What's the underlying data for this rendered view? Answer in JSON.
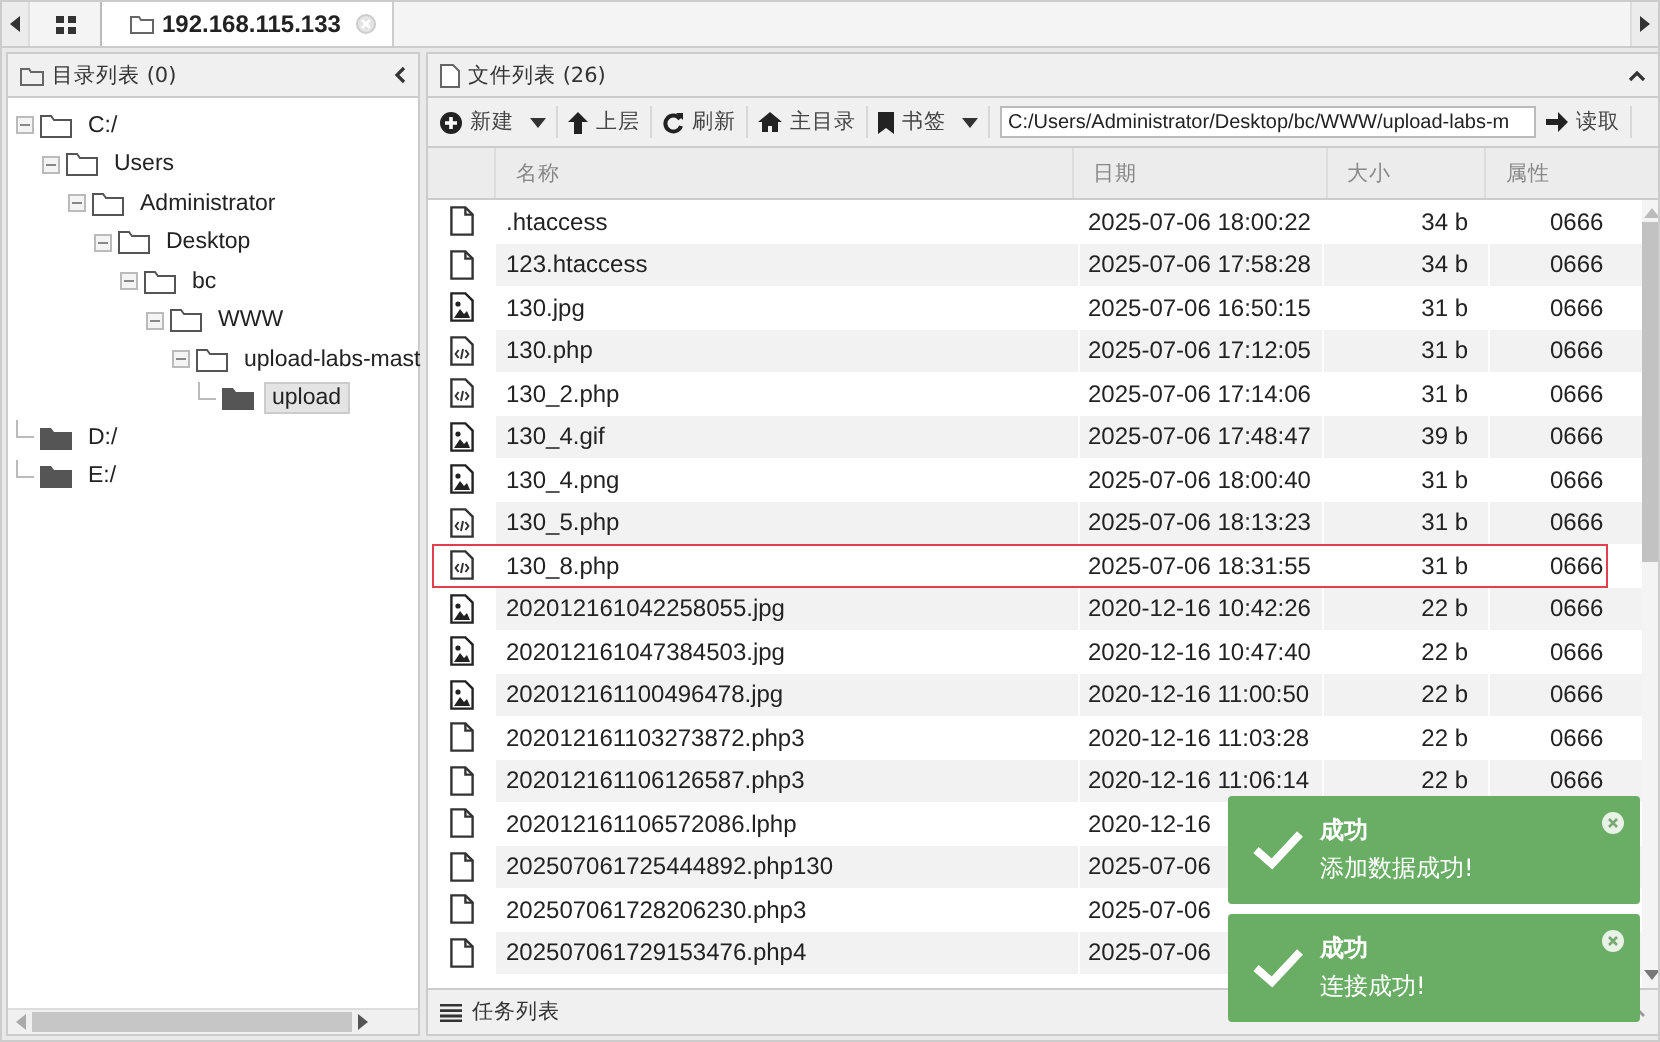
{
  "tabs": [
    {
      "label": "192.168.115.133",
      "selected": true
    }
  ],
  "tree_panel": {
    "title": "目录列表 (0)",
    "tree": [
      {
        "label": "C:/",
        "expanded": true,
        "selected": false,
        "children": [
          {
            "label": "Users",
            "expanded": true,
            "selected": false,
            "children": [
              {
                "label": "Administrator",
                "expanded": true,
                "selected": false,
                "children": [
                  {
                    "label": "Desktop",
                    "expanded": true,
                    "selected": false,
                    "children": [
                      {
                        "label": "bc",
                        "expanded": true,
                        "selected": false,
                        "children": [
                          {
                            "label": "WWW",
                            "expanded": true,
                            "selected": false,
                            "children": [
                              {
                                "label": "upload-labs-mast",
                                "expanded": true,
                                "selected": false,
                                "children": [
                                  {
                                    "label": "upload",
                                    "expanded": false,
                                    "selected": true
                                  }
                                ]
                              }
                            ]
                          }
                        ]
                      }
                    ]
                  }
                ]
              }
            ]
          }
        ]
      },
      {
        "label": "D:/",
        "expanded": false,
        "selected": false
      },
      {
        "label": "E:/",
        "expanded": false,
        "selected": false
      }
    ]
  },
  "file_panel": {
    "title": "文件列表 (26)",
    "toolbar": [
      {
        "label": "新建",
        "dropdown": true
      },
      {
        "label": "上层",
        "dropdown": false
      },
      {
        "label": "刷新",
        "dropdown": false
      },
      {
        "label": "主目录",
        "dropdown": false
      },
      {
        "label": "书签",
        "dropdown": true
      }
    ],
    "path": "C:/Users/Administrator/Desktop/bc/WWW/upload-labs-m",
    "read_button": "读取",
    "columns": [
      "名称",
      "日期",
      "大小",
      "属性"
    ],
    "rows": [
      {
        "kind": "file",
        "name": ".htaccess",
        "date": "2025-07-06 18:00:22",
        "size": "34 b",
        "attr": "0666",
        "highlighted": false
      },
      {
        "kind": "file",
        "name": "123.htaccess",
        "date": "2025-07-06 17:58:28",
        "size": "34 b",
        "attr": "0666",
        "highlighted": false
      },
      {
        "kind": "image",
        "name": "130.jpg",
        "date": "2025-07-06 16:50:15",
        "size": "31 b",
        "attr": "0666",
        "highlighted": false
      },
      {
        "kind": "code",
        "name": "130.php",
        "date": "2025-07-06 17:12:05",
        "size": "31 b",
        "attr": "0666",
        "highlighted": false
      },
      {
        "kind": "code",
        "name": "130_2.php",
        "date": "2025-07-06 17:14:06",
        "size": "31 b",
        "attr": "0666",
        "highlighted": false
      },
      {
        "kind": "image",
        "name": "130_4.gif",
        "date": "2025-07-06 17:48:47",
        "size": "39 b",
        "attr": "0666",
        "highlighted": false
      },
      {
        "kind": "image",
        "name": "130_4.png",
        "date": "2025-07-06 18:00:40",
        "size": "31 b",
        "attr": "0666",
        "highlighted": false
      },
      {
        "kind": "code",
        "name": "130_5.php",
        "date": "2025-07-06 18:13:23",
        "size": "31 b",
        "attr": "0666",
        "highlighted": false
      },
      {
        "kind": "code",
        "name": "130_8.php",
        "date": "2025-07-06 18:31:55",
        "size": "31 b",
        "attr": "0666",
        "highlighted": true
      },
      {
        "kind": "image",
        "name": "202012161042258055.jpg",
        "date": "2020-12-16 10:42:26",
        "size": "22 b",
        "attr": "0666",
        "highlighted": false
      },
      {
        "kind": "image",
        "name": "202012161047384503.jpg",
        "date": "2020-12-16 10:47:40",
        "size": "22 b",
        "attr": "0666",
        "highlighted": false
      },
      {
        "kind": "image",
        "name": "202012161100496478.jpg",
        "date": "2020-12-16 11:00:50",
        "size": "22 b",
        "attr": "0666",
        "highlighted": false
      },
      {
        "kind": "file",
        "name": "202012161103273872.php3",
        "date": "2020-12-16 11:03:28",
        "size": "22 b",
        "attr": "0666",
        "highlighted": false
      },
      {
        "kind": "file",
        "name": "202012161106126587.php3",
        "date": "2020-12-16 11:06:14",
        "size": "22 b",
        "attr": "0666",
        "highlighted": false
      },
      {
        "kind": "file",
        "name": "202012161106572086.lphp",
        "date": "2020-12-16",
        "highlighted": false
      },
      {
        "kind": "file",
        "name": "202507061725444892.php130",
        "date": "2025-07-06",
        "highlighted": false
      },
      {
        "kind": "file",
        "name": "202507061728206230.php3",
        "date": "2025-07-06",
        "highlighted": false
      },
      {
        "kind": "file",
        "name": "202507061729153476.php4",
        "date": "2025-07-06",
        "highlighted": false
      }
    ]
  },
  "task_bar": {
    "title": "任务列表"
  },
  "toasts": [
    {
      "title": "成功",
      "message": "添加数据成功!"
    },
    {
      "title": "成功",
      "message": "连接成功!"
    }
  ]
}
